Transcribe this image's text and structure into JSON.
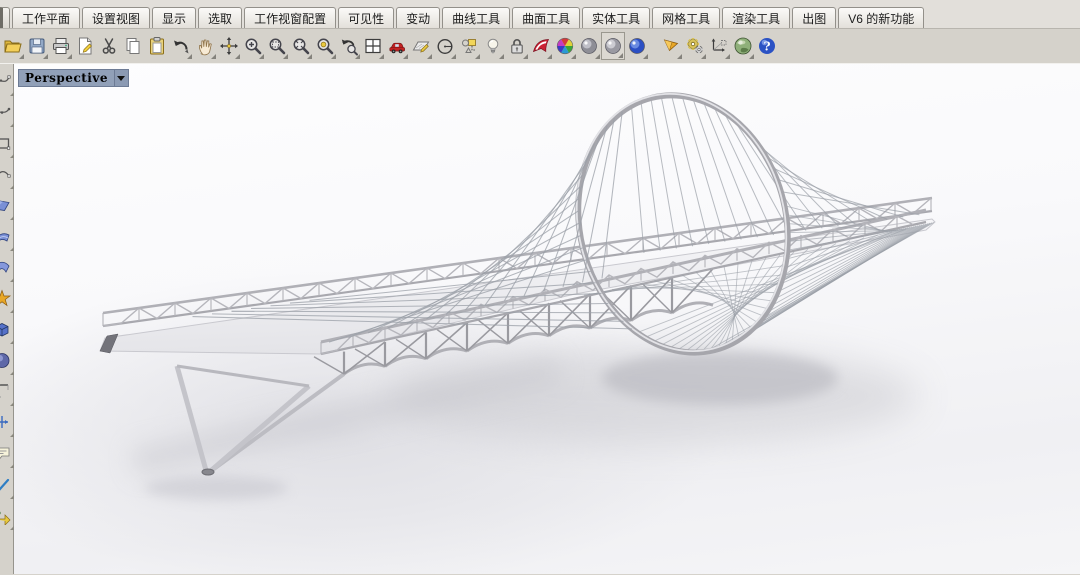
{
  "tabbar": {
    "tabs": [
      "工作平面",
      "设置视图",
      "显示",
      "选取",
      "工作视窗配置",
      "可见性",
      "变动",
      "曲线工具",
      "曲面工具",
      "实体工具",
      "网格工具",
      "渲染工具",
      "出图",
      "V6 的新功能"
    ]
  },
  "toolbar": {
    "icons": [
      "open-folder-icon",
      "save-icon",
      "print-icon",
      "new-file-icon",
      "cut-icon",
      "copy-icon",
      "paste-icon",
      "undo-icon",
      "pan-icon",
      "rotate-view-icon",
      "zoom-in-icon",
      "zoom-window-icon",
      "zoom-extents-icon",
      "zoom-selected-icon",
      "view-undo-icon",
      "viewport-layout-icon",
      "car-icon",
      "map-pen-icon",
      "circle-tool-icon",
      "select-shapes-icon",
      "lightbulb-icon",
      "lock-icon",
      "flamingo-icon",
      "color-wheel-icon",
      "render-sphere-icon",
      "render-sphere-boxed-icon",
      "blue-sphere-icon",
      "cone-icon",
      "gears-icon",
      "dimension-icon",
      "globe-icon",
      "help-icon"
    ]
  },
  "sidebar": {
    "icons": [
      "control-point-curve-icon",
      "interpolate-curve-icon",
      "rectangle-tool-icon",
      "arc-tool-icon",
      "surface-plane-icon",
      "surface-loft-icon",
      "surface-sweep-icon",
      "star-polygon-icon",
      "solid-box-icon",
      "sphere-tool-icon",
      "fillet-tool-icon",
      "transform-tool-icon",
      "annotation-tool-icon",
      "check-tool-icon",
      "gumball-tool-icon"
    ]
  },
  "viewport": {
    "label": "Perspective"
  },
  "colors": {
    "chrome": "#d5d2cb",
    "viewport_label_bg": "#91a0b8",
    "model_gray": "#b2b2b8",
    "cable_gray": "#9ba0a8"
  }
}
